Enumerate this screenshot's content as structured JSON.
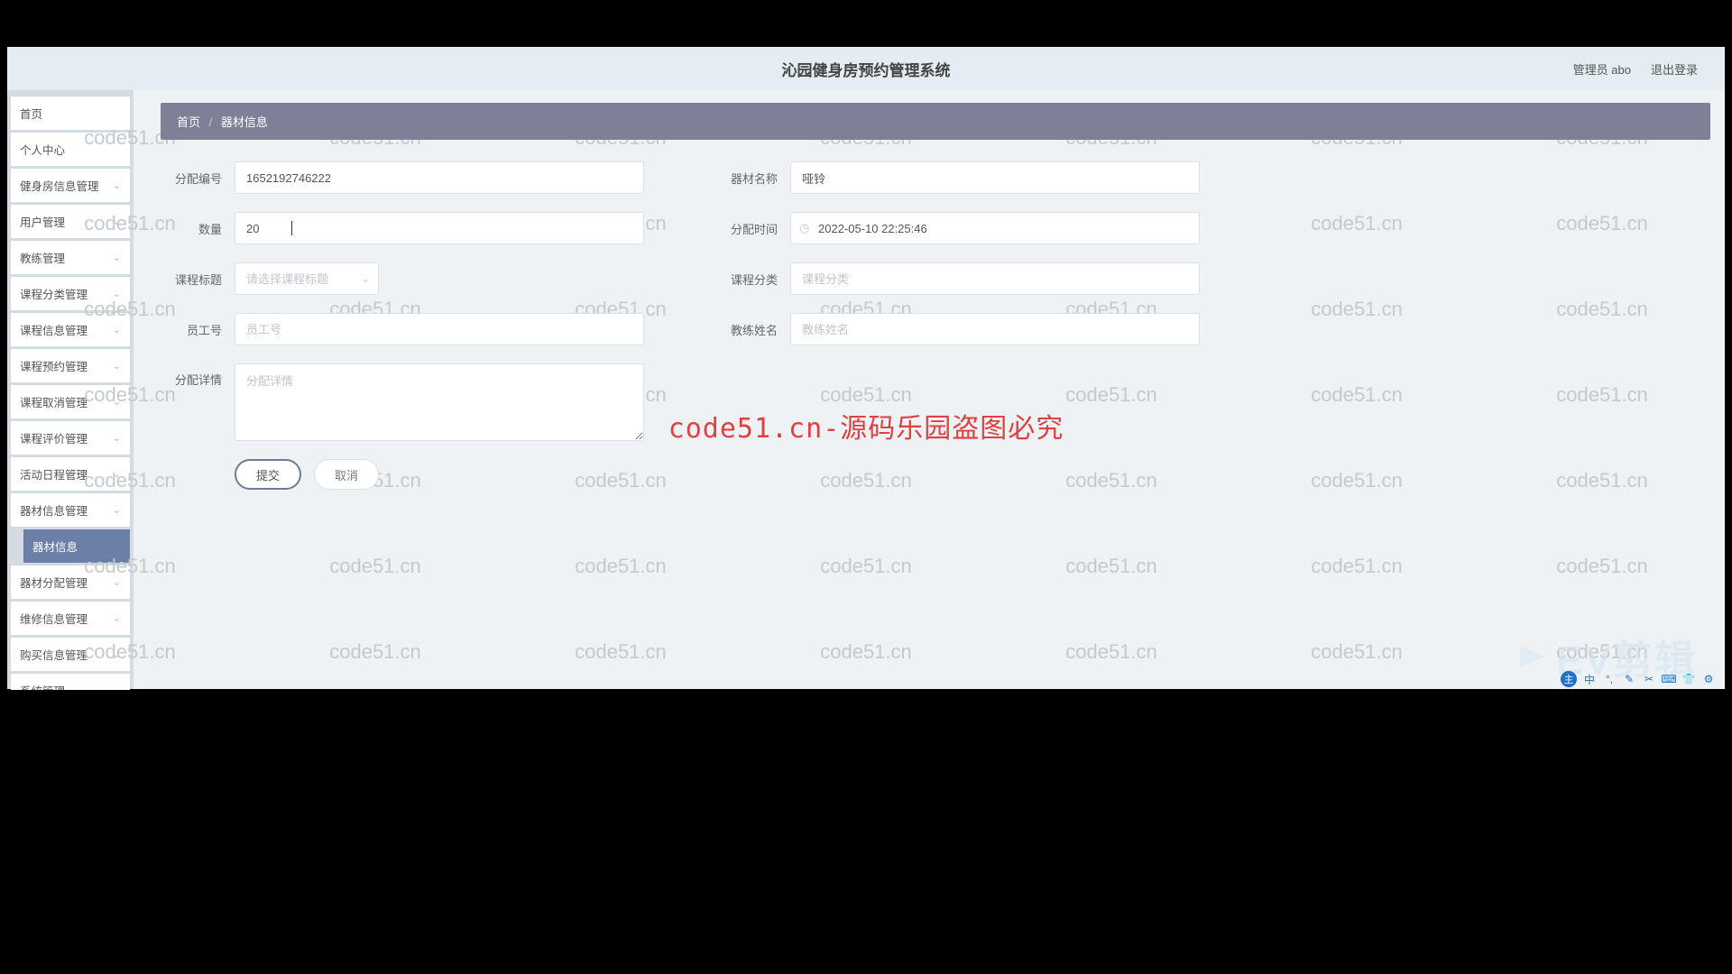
{
  "header": {
    "title": "沁园健身房预约管理系统",
    "admin_label": "管理员 abo",
    "logout_label": "退出登录"
  },
  "sidebar": {
    "items": [
      {
        "label": "首页",
        "expandable": false
      },
      {
        "label": "个人中心",
        "expandable": false
      },
      {
        "label": "健身房信息管理",
        "expandable": true
      },
      {
        "label": "用户管理",
        "expandable": true
      },
      {
        "label": "教练管理",
        "expandable": true
      },
      {
        "label": "课程分类管理",
        "expandable": true
      },
      {
        "label": "课程信息管理",
        "expandable": true
      },
      {
        "label": "课程预约管理",
        "expandable": true
      },
      {
        "label": "课程取消管理",
        "expandable": true
      },
      {
        "label": "课程评价管理",
        "expandable": true
      },
      {
        "label": "活动日程管理",
        "expandable": true
      },
      {
        "label": "器材信息管理",
        "expandable": true
      },
      {
        "label": "器材信息",
        "expandable": false,
        "active": true
      },
      {
        "label": "器材分配管理",
        "expandable": true
      },
      {
        "label": "维修信息管理",
        "expandable": true
      },
      {
        "label": "购买信息管理",
        "expandable": true
      },
      {
        "label": "系统管理",
        "expandable": true
      }
    ]
  },
  "breadcrumb": {
    "home": "首页",
    "current": "器材信息"
  },
  "form": {
    "alloc_no": {
      "label": "分配编号",
      "value": "1652192746222"
    },
    "equip_name": {
      "label": "器材名称",
      "value": "哑铃"
    },
    "quantity": {
      "label": "数量",
      "value": "20"
    },
    "alloc_time": {
      "label": "分配时间",
      "value": "2022-05-10 22:25:46"
    },
    "course_title": {
      "label": "课程标题",
      "placeholder": "请选择课程标题"
    },
    "course_cat": {
      "label": "课程分类",
      "placeholder": "课程分类"
    },
    "emp_no": {
      "label": "员工号",
      "placeholder": "员工号"
    },
    "coach_name": {
      "label": "教练姓名",
      "placeholder": "教练姓名"
    },
    "alloc_detail": {
      "label": "分配详情",
      "placeholder": "分配详情"
    },
    "submit": "提交",
    "cancel": "取消"
  },
  "watermark": {
    "text": "code51.cn",
    "center": "code51.cn-源码乐园盗图必究",
    "logo": "EV剪辑"
  }
}
